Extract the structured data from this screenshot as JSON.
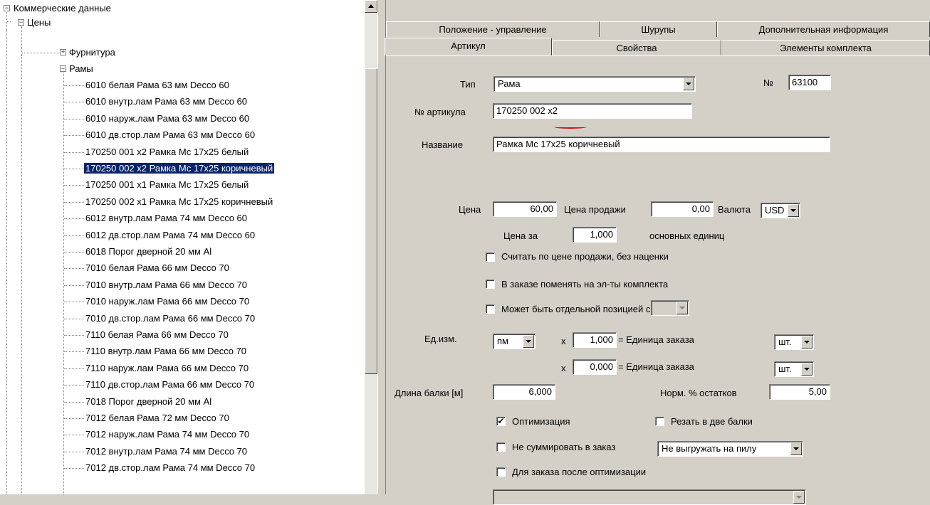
{
  "tree": {
    "root": "Коммерческие данные",
    "prices": "Цены",
    "hardware": "Фурнитура",
    "frames": "Рамы",
    "items": [
      "6010 белая Рама 63 мм Decco 60",
      "6010 внутр.лам Рама 63 мм Decco 60",
      "6010 наруж.лам Рама 63 мм Decco 60",
      "6010 дв.стор.лам Рама 63 мм Decco 60",
      "170250 001 x2 Рамка Мс 17x25 белый",
      "170250 002 x2 Рамка Мс 17x25 коричневый",
      "170250 001 x1 Рамка Мс 17x25 белый",
      "170250 002 x1 Рамка Мс 17x25 коричневый",
      "6012 внутр.лам Рама 74 мм Decco 60",
      "6012 дв.стор.лам Рама 74 мм Decco 60",
      "6018 Порог дверной 20 мм Al",
      "7010 белая Рама 66 мм Decco 70",
      "7010 внутр.лам Рама 66 мм Decco 70",
      "7010 наруж.лам Рама 66 мм Decco 70",
      "7010 дв.стор.лам Рама 66 мм Decco 70",
      "7110 белая Рама 66 мм Decco 70",
      "7110 внутр.лам Рама 66 мм Decco 70",
      "7110 наруж.лам Рама 66 мм Decco 70",
      "7110 дв.стор.лам Рама 66 мм Decco 70",
      "7018 Порог дверной 20 мм Al",
      "7012 белая Рама 72 мм Decco 70",
      "7012 наруж.лам Рама 74 мм Decco 70",
      "7012 внутр.лам Рама 74 мм Decco 70",
      "7012 дв.стор.лам Рама 74 мм Decco 70"
    ],
    "selected_index": 5
  },
  "tabs": {
    "row1": [
      "Положение - управление",
      "Шурупы",
      "Дополнительная информация"
    ],
    "row2": [
      "Артикул",
      "Свойства",
      "Элементы комплекта"
    ],
    "active": "Артикул"
  },
  "form": {
    "type_label": "Тип",
    "type_value": "Рама",
    "number_label": "№",
    "number_value": "63100",
    "article_label": "№ артикула",
    "article_value": "170250 002 x2",
    "name_label": "Название",
    "name_value": "Рамка Мс 17x25 коричневый",
    "price_label": "Цена",
    "price_value": "60,00",
    "sale_price_label": "Цена продажи",
    "sale_price_value": "0,00",
    "currency_label": "Валюта",
    "currency_value": "USD",
    "price_per_label": "Цена за",
    "price_per_value": "1,000",
    "base_units_label": "основных единиц",
    "cb_sale_price": "Считать по цене продажи, без наценки",
    "cb_replace": "В заказе поменять на эл-ты комплекта",
    "cb_separate": "Может быть отдельной позицией счета; со ста",
    "unit_label": "Ед.изм.",
    "unit_value": "пм",
    "mult1": "x",
    "factor1": "1,000",
    "order_unit1_label": "= Единица заказа",
    "order_unit1_value": "шт.",
    "mult2": "x",
    "factor2": "0,000",
    "order_unit2_label": "= Единица заказа",
    "order_unit2_value": "шт.",
    "bar_length_label": "Длина балки [м]",
    "bar_length_value": "6,000",
    "norm_rest_label": "Норм. % остатков",
    "norm_rest_value": "5,00",
    "cb_optimization": "Оптимизация",
    "cb_optimization_checked": true,
    "cb_cut_two": "Резать в две балки",
    "cb_no_sum": "Не суммировать в заказ",
    "saw_value": "Не выгружать на пилу",
    "cb_after_opt": "Для заказа после оптимизации"
  }
}
